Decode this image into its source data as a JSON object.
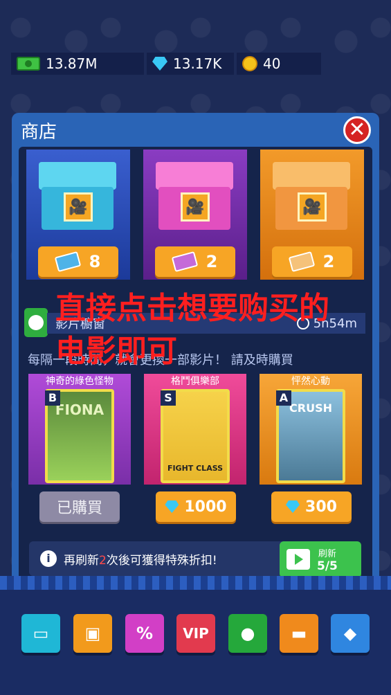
{
  "currency": {
    "money": "13.87M",
    "gems": "13.17K",
    "coins": "40"
  },
  "shop": {
    "title": "商店",
    "close": "✕"
  },
  "chests": [
    {
      "price": "8",
      "color": "#3ec8e8",
      "bg": "#2650b8"
    },
    {
      "price": "2",
      "color": "#f160c8",
      "bg": "#7a2fb0"
    },
    {
      "price": "2",
      "color": "#f7a84a",
      "bg": "#e37f12"
    }
  ],
  "overlay": {
    "line1": "直接点击想要购买的",
    "line2": "电影即可"
  },
  "movie_list": {
    "header": "影片櫥窗",
    "timer": "5h54m",
    "notice": "每隔一段時間，就會更換一部影片！ 請及時購買"
  },
  "movies": [
    {
      "title": "神奇的綠色怪物",
      "grade": "B",
      "poster_text": "FIONA",
      "button": "已購買",
      "purchased": true
    },
    {
      "title": "格鬥俱樂部",
      "grade": "S",
      "poster_text": "FIGHT CLASS",
      "button": "1000",
      "purchased": false
    },
    {
      "title": "怦然心動",
      "grade": "A",
      "poster_text": "CRUSH",
      "button": "300",
      "purchased": false
    }
  ],
  "refresh": {
    "text_before": "再刷新",
    "highlight": "2",
    "text_after": "次後可獲得特殊折扣!",
    "button_label": "刷新",
    "count": "5/5"
  },
  "nav": [
    {
      "label": "",
      "color": "#1fb7d6",
      "icon": "chest-icon"
    },
    {
      "label": "",
      "color": "#f29a1c",
      "icon": "gift-icon"
    },
    {
      "label": "%",
      "color": "#d23fc6",
      "icon": "discount-tag-icon"
    },
    {
      "label": "VIP",
      "color": "#e23a4e",
      "icon": "vip-icon"
    },
    {
      "label": "",
      "color": "#25a83b",
      "icon": "manager-icon"
    },
    {
      "label": "",
      "color": "#f08a1c",
      "icon": "cash-icon"
    },
    {
      "label": "",
      "color": "#2f86e0",
      "icon": "diamond-icon"
    }
  ]
}
